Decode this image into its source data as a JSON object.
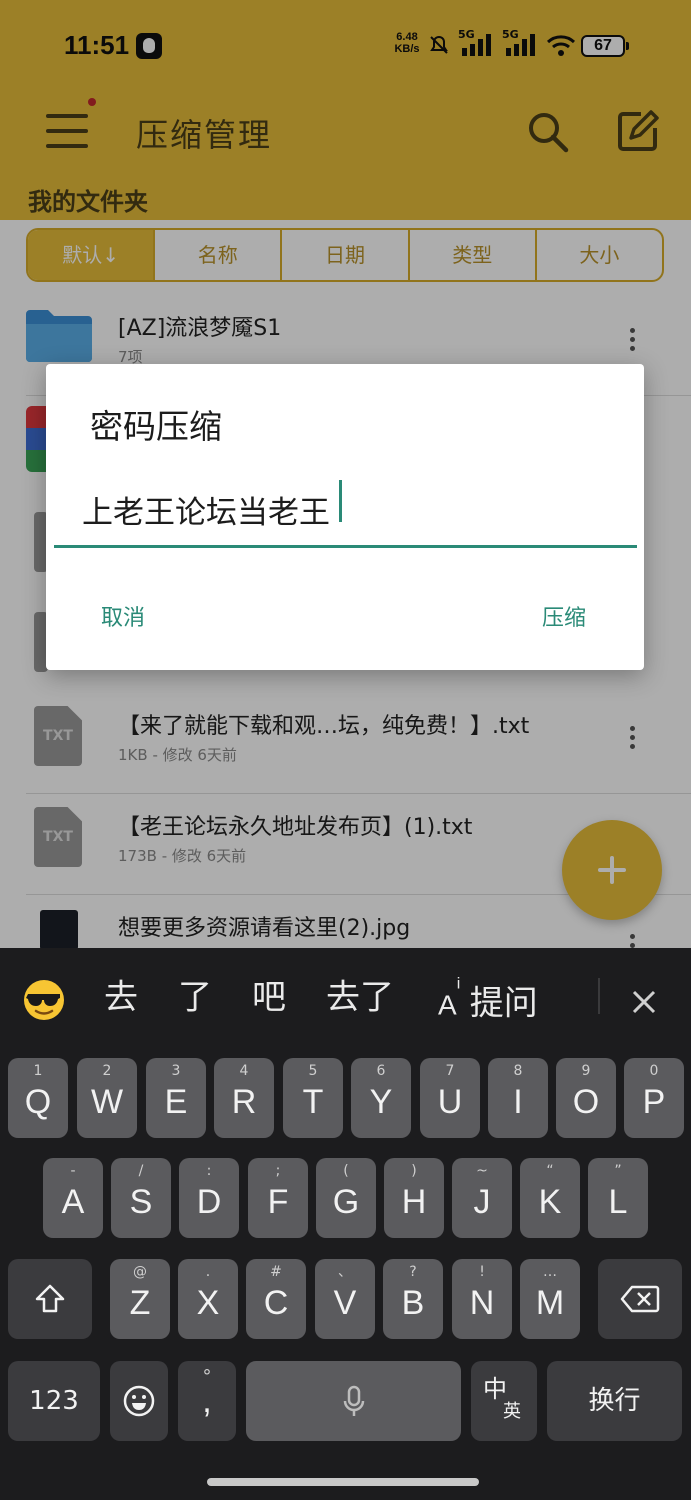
{
  "status_bar": {
    "time": "11:51",
    "net_speed_value": "6.48",
    "net_speed_unit": "KB/s",
    "signal_1": "5G",
    "signal_2": "5G",
    "battery": "67",
    "icons": [
      "qq-icon",
      "mute-icon",
      "signal-icon",
      "signal-icon",
      "wifi-icon",
      "battery-icon"
    ]
  },
  "app_bar": {
    "title": "压缩管理",
    "section": "我的文件夹",
    "icons": [
      "menu-icon",
      "search-icon",
      "edit-icon"
    ]
  },
  "sort_tabs": [
    {
      "label": "默认↓",
      "active": true
    },
    {
      "label": "名称",
      "active": false
    },
    {
      "label": "日期",
      "active": false
    },
    {
      "label": "类型",
      "active": false
    },
    {
      "label": "大小",
      "active": false
    }
  ],
  "files": [
    {
      "name": "[AZ]流浪梦魇S1",
      "meta": "7项",
      "icon": "folder-icon"
    },
    {
      "name": "【来了就能下载和观…坛，纯免费！】.txt",
      "meta": "1KB - 修改 6天前",
      "icon": "txt-icon",
      "icon_text": "TXT"
    },
    {
      "name": "【老王论坛永久地址发布页】(1).txt",
      "meta": "173B - 修改 6天前",
      "icon": "txt-icon",
      "icon_text": "TXT"
    },
    {
      "name": "想要更多资源请看这里(2).jpg",
      "meta": "",
      "icon": "image-thumb-icon"
    }
  ],
  "dialog": {
    "title": "密码压缩",
    "input_value": "上老王论坛当老王",
    "cancel_label": "取消",
    "confirm_label": "压缩"
  },
  "keyboard": {
    "candidates": [
      "去",
      "了",
      "吧",
      "去了"
    ],
    "ai_label": "提问",
    "row1": [
      {
        "hint": "1",
        "key": "Q"
      },
      {
        "hint": "2",
        "key": "W"
      },
      {
        "hint": "3",
        "key": "E"
      },
      {
        "hint": "4",
        "key": "R"
      },
      {
        "hint": "5",
        "key": "T"
      },
      {
        "hint": "6",
        "key": "Y"
      },
      {
        "hint": "7",
        "key": "U"
      },
      {
        "hint": "8",
        "key": "I"
      },
      {
        "hint": "9",
        "key": "O"
      },
      {
        "hint": "0",
        "key": "P"
      }
    ],
    "row2": [
      {
        "hint": "-",
        "key": "A"
      },
      {
        "hint": "/",
        "key": "S"
      },
      {
        "hint": ":",
        "key": "D"
      },
      {
        "hint": ";",
        "key": "F"
      },
      {
        "hint": "(",
        "key": "G"
      },
      {
        "hint": ")",
        "key": "H"
      },
      {
        "hint": "~",
        "key": "J"
      },
      {
        "hint": "“",
        "key": "K"
      },
      {
        "hint": "”",
        "key": "L"
      }
    ],
    "row3": [
      {
        "hint": "@",
        "key": "Z"
      },
      {
        "hint": ".",
        "key": "X"
      },
      {
        "hint": "#",
        "key": "C"
      },
      {
        "hint": "、",
        "key": "V"
      },
      {
        "hint": "?",
        "key": "B"
      },
      {
        "hint": "!",
        "key": "N"
      },
      {
        "hint": "…",
        "key": "M"
      }
    ],
    "numbers_label": "123",
    "punct_hint": "°",
    "punct_key": ",",
    "lang_main": "中",
    "lang_sub": "英",
    "enter_label": "换行"
  }
}
